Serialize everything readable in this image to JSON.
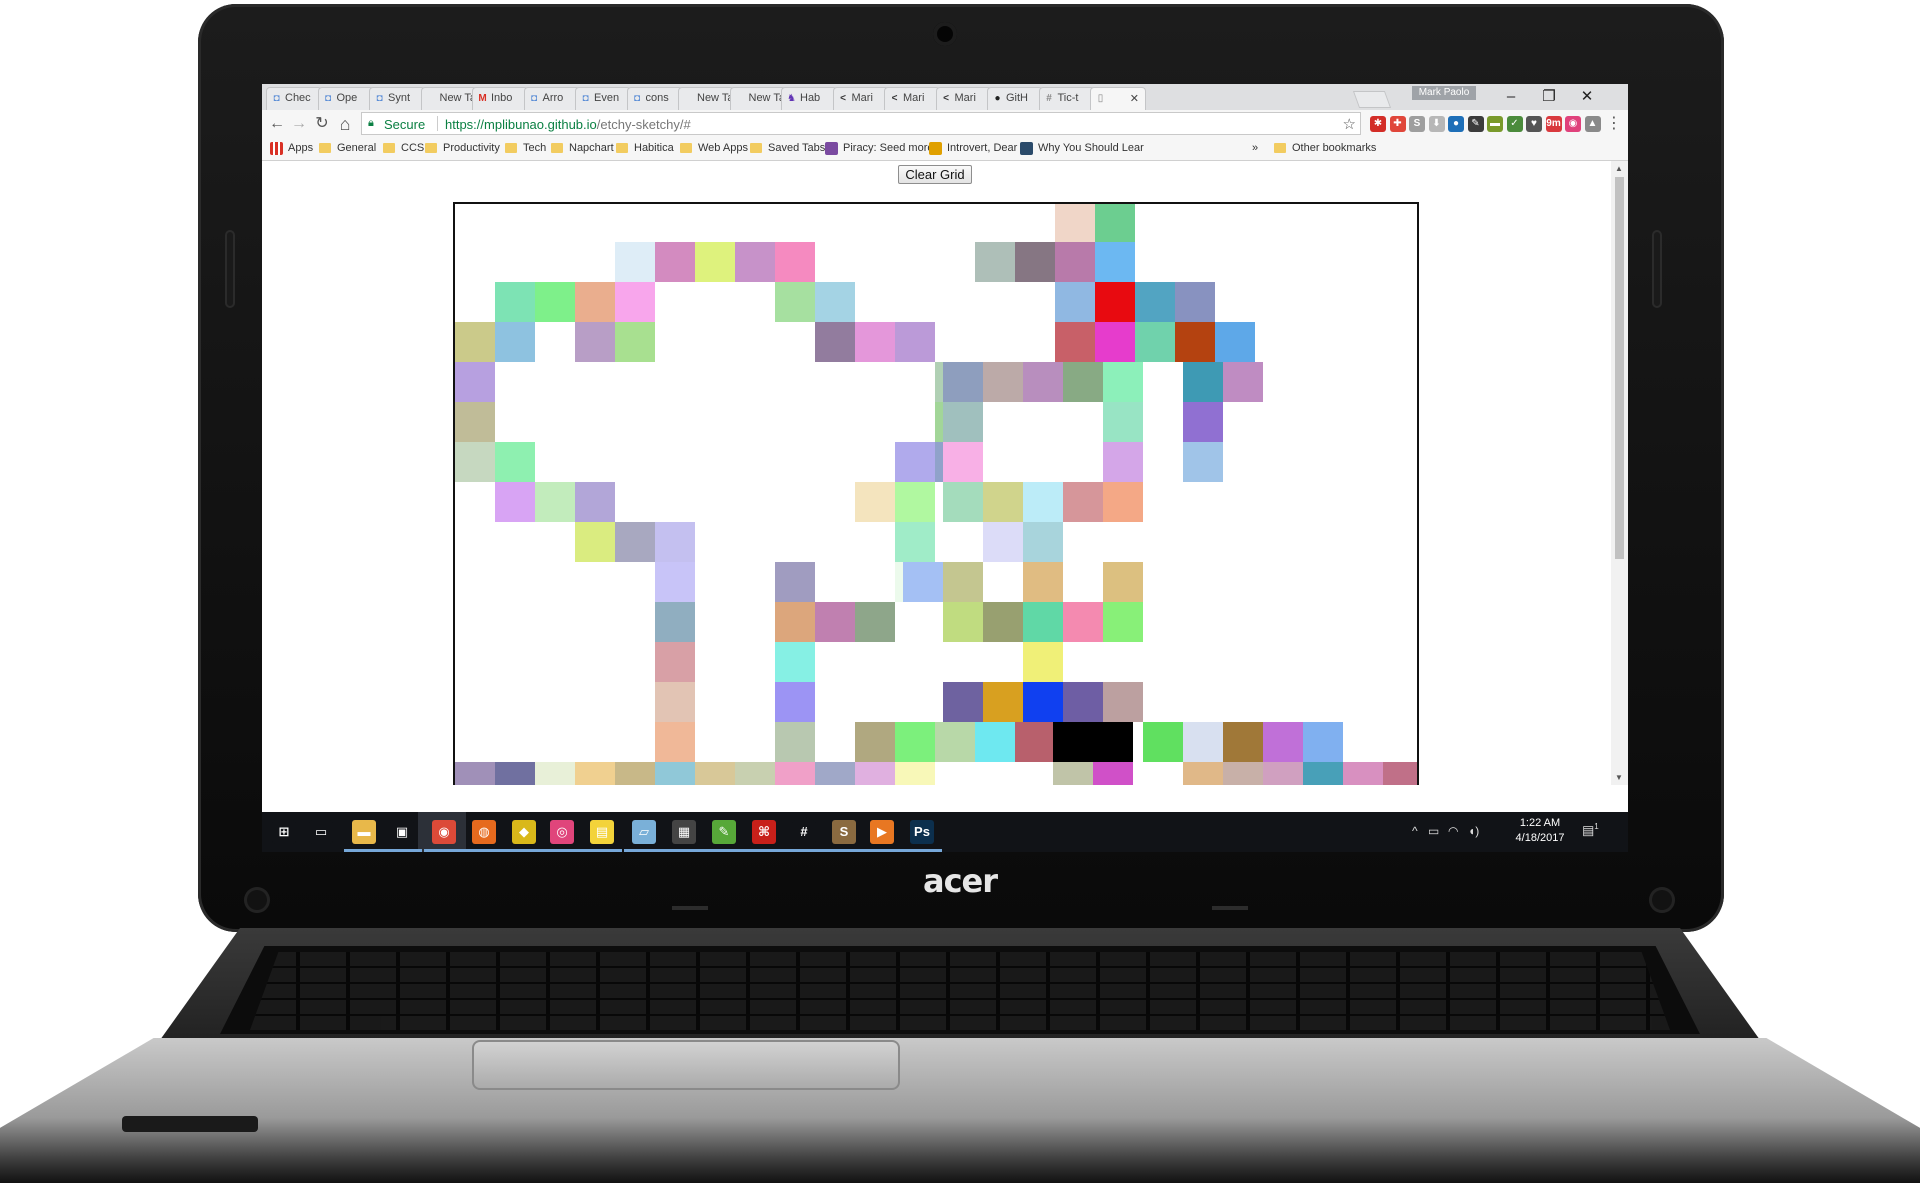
{
  "brand": "acer",
  "browser": {
    "tabs": [
      {
        "label": "Chec",
        "icon": "code-icon",
        "color": "#5a8dd6"
      },
      {
        "label": "Ope",
        "icon": "code-icon",
        "color": "#5a8dd6"
      },
      {
        "label": "Synt",
        "icon": "code-icon",
        "color": "#5a8dd6"
      },
      {
        "label": "New Tab",
        "icon": "",
        "color": ""
      },
      {
        "label": "Inbo",
        "icon": "gmail-icon",
        "color": "#d93025"
      },
      {
        "label": "Arro",
        "icon": "code-icon",
        "color": "#5a8dd6"
      },
      {
        "label": "Even",
        "icon": "code-icon",
        "color": "#5a8dd6"
      },
      {
        "label": "cons",
        "icon": "code-icon",
        "color": "#5a8dd6"
      },
      {
        "label": "New Tab",
        "icon": "",
        "color": ""
      },
      {
        "label": "New Tab",
        "icon": "",
        "color": ""
      },
      {
        "label": "Hab",
        "icon": "habitica-icon",
        "color": "#6133b4"
      },
      {
        "label": "Mari",
        "icon": "markup-icon",
        "color": "#333333"
      },
      {
        "label": "Mari",
        "icon": "markup-icon",
        "color": "#333333"
      },
      {
        "label": "Mari",
        "icon": "markup-icon",
        "color": "#333333"
      },
      {
        "label": "GitH",
        "icon": "github-icon",
        "color": "#222222"
      },
      {
        "label": "Tic-t",
        "icon": "hash-icon",
        "color": "#888888"
      },
      {
        "label": "",
        "icon": "page-icon",
        "color": "#888888"
      }
    ],
    "user": "Mark Paolo",
    "window_controls": {
      "minimize": "–",
      "restore": "❐",
      "close": "✕"
    },
    "nav": {
      "back": "←",
      "forward": "→",
      "reload": "↻",
      "home": "⌂"
    },
    "omnibox": {
      "secure_label": "Secure",
      "url_host": "https://mplibunao.github.io",
      "url_path": "/etchy-sketchy/#",
      "star": "☆"
    },
    "extensions": [
      {
        "name": "lastpass-icon",
        "color": "#d32d27",
        "glyph": "✱"
      },
      {
        "name": "ext-red-icon",
        "color": "#e0463a",
        "glyph": "✚"
      },
      {
        "name": "ext-s-icon",
        "color": "#9e9e9e",
        "glyph": "S"
      },
      {
        "name": "pdf-icon",
        "color": "#b7b7b7",
        "glyph": "⬇"
      },
      {
        "name": "edge-icon",
        "color": "#1e6fb8",
        "glyph": "●"
      },
      {
        "name": "evernote-icon",
        "color": "#3c3c3c",
        "glyph": "✎"
      },
      {
        "name": "ext-green-icon",
        "color": "#7a9a2b",
        "glyph": "▬"
      },
      {
        "name": "ext-leaf-icon",
        "color": "#4b8b3b",
        "glyph": "✓"
      },
      {
        "name": "pocket-icon",
        "color": "#555555",
        "glyph": "♥"
      },
      {
        "name": "timer-icon",
        "color": "#d9393e",
        "glyph": "9m"
      },
      {
        "name": "ext-circle-icon",
        "color": "#e0417b",
        "glyph": "◉"
      },
      {
        "name": "ext-cam-icon",
        "color": "#8a8a8a",
        "glyph": "▲"
      }
    ],
    "menu": "⋮",
    "bookmarks": [
      {
        "label": "Apps",
        "kind": "apps"
      },
      {
        "label": "General",
        "kind": "folder"
      },
      {
        "label": "CCS",
        "kind": "folder"
      },
      {
        "label": "Productivity",
        "kind": "folder"
      },
      {
        "label": "Tech",
        "kind": "folder"
      },
      {
        "label": "Napchart",
        "kind": "folder"
      },
      {
        "label": "Habitica",
        "kind": "folder"
      },
      {
        "label": "Web Apps",
        "kind": "folder"
      },
      {
        "label": "Saved Tabs",
        "kind": "folder"
      },
      {
        "label": "Piracy: Seed more",
        "kind": "site"
      },
      {
        "label": "Introvert, Dear",
        "kind": "site"
      },
      {
        "label": "Why You Should Lear",
        "kind": "site"
      }
    ],
    "overflow": "»",
    "other_bookmarks": "Other bookmarks"
  },
  "page": {
    "clear_button": "Clear Grid",
    "grid_cells": [
      {
        "c": 15,
        "r": 0,
        "color": "#f0d6c8"
      },
      {
        "c": 16,
        "r": 0,
        "color": "#6cce90"
      },
      {
        "c": 4,
        "r": 1,
        "color": "#deedf7"
      },
      {
        "c": 5,
        "r": 1,
        "color": "#d38bc0"
      },
      {
        "c": 6,
        "r": 1,
        "color": "#def27d"
      },
      {
        "c": 7,
        "r": 1,
        "color": "#c792c9"
      },
      {
        "c": 8,
        "r": 1,
        "color": "#f58ac0"
      },
      {
        "c": 13,
        "r": 1,
        "color": "#aebfb8"
      },
      {
        "c": 14,
        "r": 1,
        "color": "#867683"
      },
      {
        "c": 15,
        "r": 1,
        "color": "#b87aaa"
      },
      {
        "c": 16,
        "r": 1,
        "color": "#6cb8f2"
      },
      {
        "c": 1,
        "r": 2,
        "color": "#7de3b4"
      },
      {
        "c": 2,
        "r": 2,
        "color": "#7ef08a"
      },
      {
        "c": 3,
        "r": 2,
        "color": "#eaae8e"
      },
      {
        "c": 4,
        "r": 2,
        "color": "#f8a6ec"
      },
      {
        "c": 8,
        "r": 2,
        "color": "#a6e0a0"
      },
      {
        "c": 9,
        "r": 2,
        "color": "#a4d3e4"
      },
      {
        "c": 15,
        "r": 2,
        "color": "#90b8e2"
      },
      {
        "c": 16,
        "r": 2,
        "color": "#e80a10"
      },
      {
        "c": 17,
        "r": 2,
        "color": "#52a4c2"
      },
      {
        "c": 18,
        "r": 2,
        "color": "#8892c0"
      },
      {
        "c": 0,
        "r": 3,
        "color": "#cbca8a"
      },
      {
        "c": 1,
        "r": 3,
        "color": "#8ec2e0"
      },
      {
        "c": 3,
        "r": 3,
        "color": "#b89ec6"
      },
      {
        "c": 4,
        "r": 3,
        "color": "#a8e090"
      },
      {
        "c": 9,
        "r": 3,
        "color": "#927c9e"
      },
      {
        "c": 10,
        "r": 3,
        "color": "#e497da"
      },
      {
        "c": 11,
        "r": 3,
        "color": "#bb9ad8"
      },
      {
        "c": 15,
        "r": 3,
        "color": "#c86068"
      },
      {
        "c": 16,
        "r": 3,
        "color": "#e63ccc"
      },
      {
        "c": 17,
        "r": 3,
        "color": "#70d2ac"
      },
      {
        "c": 18,
        "r": 3,
        "color": "#b44210"
      },
      {
        "c": 19,
        "r": 3,
        "color": "#5ea8e8"
      },
      {
        "c": 0,
        "r": 4,
        "color": "#b7a0e0"
      },
      {
        "c": 12,
        "r": 4,
        "color": "#b0d0b4"
      },
      {
        "c": 12.2,
        "r": 4,
        "color": "#8e9ebe"
      },
      {
        "c": 13.2,
        "r": 4,
        "color": "#bcaaa8"
      },
      {
        "c": 14.2,
        "r": 4,
        "color": "#b88ebe"
      },
      {
        "c": 15.2,
        "r": 4,
        "color": "#88aa84"
      },
      {
        "c": 16.2,
        "r": 4,
        "color": "#8cf0ba"
      },
      {
        "c": 18.2,
        "r": 4,
        "color": "#3e9ab4"
      },
      {
        "c": 19.2,
        "r": 4,
        "color": "#bf8cc2"
      },
      {
        "c": 0,
        "r": 5,
        "color": "#c0bc98"
      },
      {
        "c": 12,
        "r": 5,
        "color": "#a2d698"
      },
      {
        "c": 12.2,
        "r": 5,
        "color": "#a0c0be"
      },
      {
        "c": 16.2,
        "r": 5,
        "color": "#98e4c4"
      },
      {
        "c": 18.2,
        "r": 5,
        "color": "#9070d2"
      },
      {
        "c": 0,
        "r": 6,
        "color": "#c6d8c0"
      },
      {
        "c": 1,
        "r": 6,
        "color": "#8ef0b0"
      },
      {
        "c": 11,
        "r": 6,
        "color": "#b0aaec"
      },
      {
        "c": 12,
        "r": 6,
        "color": "#90a2ca"
      },
      {
        "c": 12.2,
        "r": 6,
        "color": "#f8b0e6"
      },
      {
        "c": 16.2,
        "r": 6,
        "color": "#d4a6e8"
      },
      {
        "c": 18.2,
        "r": 6,
        "color": "#a0c4e8"
      },
      {
        "c": 1,
        "r": 7,
        "color": "#d8a4f4"
      },
      {
        "c": 2,
        "r": 7,
        "color": "#c2ecbc"
      },
      {
        "c": 3,
        "r": 7,
        "color": "#b2a6d8"
      },
      {
        "c": 10,
        "r": 7,
        "color": "#f4e4be"
      },
      {
        "c": 11,
        "r": 7,
        "color": "#b0f8a0"
      },
      {
        "c": 12.2,
        "r": 7,
        "color": "#a4dcbc"
      },
      {
        "c": 13.2,
        "r": 7,
        "color": "#d0d48c"
      },
      {
        "c": 14.2,
        "r": 7,
        "color": "#bcecf8"
      },
      {
        "c": 15.2,
        "r": 7,
        "color": "#d6969a"
      },
      {
        "c": 16.2,
        "r": 7,
        "color": "#f4a886"
      },
      {
        "c": 3,
        "r": 8,
        "color": "#daec80"
      },
      {
        "c": 4,
        "r": 8,
        "color": "#a8a8c0"
      },
      {
        "c": 5,
        "r": 8,
        "color": "#c4c0f0"
      },
      {
        "c": 11,
        "r": 8,
        "color": "#a0ecc8"
      },
      {
        "c": 13.2,
        "r": 8,
        "color": "#dcdcf8"
      },
      {
        "c": 14.2,
        "r": 8,
        "color": "#a8d4dc"
      },
      {
        "c": 5,
        "r": 9,
        "color": "#c8c4f8"
      },
      {
        "c": 8,
        "r": 9,
        "color": "#a09cc0"
      },
      {
        "c": 11,
        "r": 9,
        "color": "#ecfaec"
      },
      {
        "c": 11.2,
        "r": 9,
        "color": "#a4c0f4"
      },
      {
        "c": 12.2,
        "r": 9,
        "color": "#c4c690"
      },
      {
        "c": 14.2,
        "r": 9,
        "color": "#e0bc82"
      },
      {
        "c": 16.2,
        "r": 9,
        "color": "#dcc080"
      },
      {
        "c": 5,
        "r": 10,
        "color": "#90aec0"
      },
      {
        "c": 8,
        "r": 10,
        "color": "#dca67c"
      },
      {
        "c": 9,
        "r": 10,
        "color": "#c080b0"
      },
      {
        "c": 10,
        "r": 10,
        "color": "#8ea68a"
      },
      {
        "c": 12.2,
        "r": 10,
        "color": "#c0dc80"
      },
      {
        "c": 13.2,
        "r": 10,
        "color": "#98a070"
      },
      {
        "c": 14.2,
        "r": 10,
        "color": "#60d8a6"
      },
      {
        "c": 15.2,
        "r": 10,
        "color": "#f48ab0"
      },
      {
        "c": 16.2,
        "r": 10,
        "color": "#88f078"
      },
      {
        "c": 5,
        "r": 11,
        "color": "#d8a0a6"
      },
      {
        "c": 8,
        "r": 11,
        "color": "#86f0e4"
      },
      {
        "c": 14.2,
        "r": 11,
        "color": "#f0f078"
      },
      {
        "c": 5,
        "r": 12,
        "color": "#e2c4b4"
      },
      {
        "c": 8,
        "r": 12,
        "color": "#9c94f4"
      },
      {
        "c": 12.2,
        "r": 12,
        "color": "#6e62a0"
      },
      {
        "c": 13.2,
        "r": 12,
        "color": "#d8a020"
      },
      {
        "c": 14.2,
        "r": 12,
        "color": "#1040f0"
      },
      {
        "c": 15.2,
        "r": 12,
        "color": "#6e5ea4"
      },
      {
        "c": 16.2,
        "r": 12,
        "color": "#bca0a0"
      },
      {
        "c": 5,
        "r": 13,
        "color": "#f0b898"
      },
      {
        "c": 8,
        "r": 13,
        "color": "#b8c8b0"
      },
      {
        "c": 10,
        "r": 13,
        "color": "#b0a880"
      },
      {
        "c": 11,
        "r": 13,
        "color": "#7cf07c"
      },
      {
        "c": 12,
        "r": 13,
        "color": "#b8d8a8"
      },
      {
        "c": 13,
        "r": 13,
        "color": "#6ee8f0"
      },
      {
        "c": 14,
        "r": 13,
        "color": "#b8606c"
      },
      {
        "c": 14.95,
        "r": 13,
        "color": "#000000"
      },
      {
        "c": 15.95,
        "r": 13,
        "color": "#000000"
      },
      {
        "c": 17.2,
        "r": 13,
        "color": "#60e060"
      },
      {
        "c": 18.2,
        "r": 13,
        "color": "#d8e0f0"
      },
      {
        "c": 19.2,
        "r": 13,
        "color": "#a07838"
      },
      {
        "c": 20.2,
        "r": 13,
        "color": "#c070d8"
      },
      {
        "c": 21.2,
        "r": 13,
        "color": "#80b0f0"
      },
      {
        "c": 0,
        "r": 14,
        "color": "#a090b8"
      },
      {
        "c": 1,
        "r": 14,
        "color": "#7070a0"
      },
      {
        "c": 2,
        "r": 14,
        "color": "#e8f0d8"
      },
      {
        "c": 3,
        "r": 14,
        "color": "#f0d090"
      },
      {
        "c": 4,
        "r": 14,
        "color": "#c8b888"
      },
      {
        "c": 5,
        "r": 14,
        "color": "#90c8d8"
      },
      {
        "c": 6,
        "r": 14,
        "color": "#d8c898"
      },
      {
        "c": 7,
        "r": 14,
        "color": "#c8d0b0"
      },
      {
        "c": 8,
        "r": 14,
        "color": "#f0a0c8"
      },
      {
        "c": 9,
        "r": 14,
        "color": "#a0a8c8"
      },
      {
        "c": 10,
        "r": 14,
        "color": "#e0b0e0"
      },
      {
        "c": 11,
        "r": 14,
        "color": "#f8f8b8"
      },
      {
        "c": 12,
        "r": 14,
        "color": "#ffffff"
      },
      {
        "c": 14.95,
        "r": 14,
        "color": "#c0c4a8"
      },
      {
        "c": 15.95,
        "r": 14,
        "color": "#d050c8"
      },
      {
        "c": 17.2,
        "r": 14,
        "color": "#ffffff"
      },
      {
        "c": 18.2,
        "r": 14,
        "color": "#e0b888"
      },
      {
        "c": 19.2,
        "r": 14,
        "color": "#c8b0a8"
      },
      {
        "c": 20.2,
        "r": 14,
        "color": "#d0a0c0"
      },
      {
        "c": 21.2,
        "r": 14,
        "color": "#48a0b8"
      },
      {
        "c": 22.2,
        "r": 14,
        "color": "#d890c0"
      },
      {
        "c": 23.2,
        "r": 14,
        "color": "#c07088"
      }
    ]
  },
  "taskbar": {
    "apps": [
      {
        "name": "start-icon",
        "glyph": "⊞",
        "color": "#111317"
      },
      {
        "name": "task-view-icon",
        "glyph": "▭",
        "color": "#111317"
      },
      {
        "name": "file-explorer-icon",
        "glyph": "▬",
        "color": "#e8b84a"
      },
      {
        "name": "store-icon",
        "glyph": "▣",
        "color": "#111317"
      },
      {
        "name": "chrome-icon",
        "glyph": "◉",
        "color": "#dc4a38"
      },
      {
        "name": "firefox-icon",
        "glyph": "◍",
        "color": "#e66a1e"
      },
      {
        "name": "tray-app-icon",
        "glyph": "◆",
        "color": "#d9b81a"
      },
      {
        "name": "pink-app-icon",
        "glyph": "◎",
        "color": "#e0457b"
      },
      {
        "name": "sticky-notes-icon",
        "glyph": "▤",
        "color": "#f3d33a"
      },
      {
        "name": "notepad-icon",
        "glyph": "▱",
        "color": "#7ab0d8"
      },
      {
        "name": "calculator-icon",
        "glyph": "▦",
        "color": "#444444"
      },
      {
        "name": "evernote-icon",
        "glyph": "✎",
        "color": "#57a839"
      },
      {
        "name": "acrobat-icon",
        "glyph": "⌘",
        "color": "#c8201a"
      },
      {
        "name": "slack-icon",
        "glyph": "#",
        "color": "#111317"
      },
      {
        "name": "sublime-icon",
        "glyph": "S",
        "color": "#8a6a40"
      },
      {
        "name": "media-player-icon",
        "glyph": "▶",
        "color": "#e87722"
      },
      {
        "name": "photoshop-icon",
        "glyph": "Ps",
        "color": "#0c2f4d"
      }
    ],
    "tray": {
      "chevron": "^",
      "battery": "▭",
      "wifi": "◠",
      "volume": "◖)"
    },
    "time": "1:22 AM",
    "date": "4/18/2017",
    "notifications": "1"
  }
}
